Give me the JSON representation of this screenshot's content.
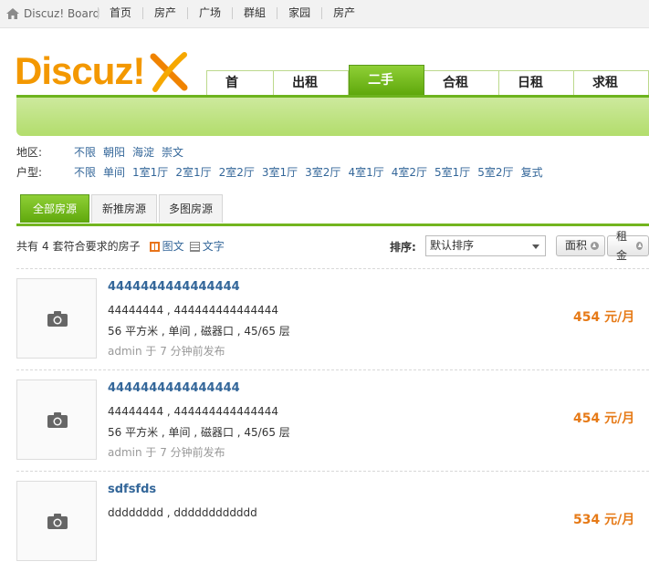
{
  "topbar": {
    "board_label": "Discuz! Board",
    "nav": [
      "首页",
      "房产",
      "广场",
      "群組",
      "家园",
      "房产"
    ]
  },
  "logo": {
    "text": "Discuz!"
  },
  "mainnav": {
    "tabs": [
      {
        "label": "首 页",
        "active": false
      },
      {
        "label": "出租房",
        "active": false
      },
      {
        "label": "二手房",
        "active": true
      },
      {
        "label": "合租房",
        "active": false
      },
      {
        "label": "日租房",
        "active": false
      },
      {
        "label": "求租房",
        "active": false
      }
    ]
  },
  "filters": {
    "area": {
      "label": "地区:",
      "options": [
        "不限",
        "朝阳",
        "海淀",
        "崇文"
      ]
    },
    "layout": {
      "label": "户型:",
      "options": [
        "不限",
        "单间",
        "1室1厅",
        "2室1厅",
        "2室2厅",
        "3室1厅",
        "3室2厅",
        "4室1厅",
        "4室2厅",
        "5室1厅",
        "5室2厅",
        "复式"
      ]
    }
  },
  "subtabs": [
    "全部房源",
    "新推房源",
    "多图房源"
  ],
  "results": {
    "prefix": "共有",
    "count": "4",
    "suffix": "套符合要求的房子",
    "view_image": "图文",
    "view_text": "文字",
    "sort_label": "排序:",
    "sort_value": "默认排序",
    "btn_area": "面积",
    "btn_rent": "租金"
  },
  "listings": [
    {
      "title": "4444444444444444",
      "line1": "44444444 , 444444444444444",
      "line2": "56 平方米 , 单间 , 磁器口 , 45/65 层",
      "line3": "admin 于 7 分钟前发布",
      "price": "454 元/月"
    },
    {
      "title": "4444444444444444",
      "line1": "44444444 , 444444444444444",
      "line2": "56 平方米 , 单间 , 磁器口 , 45/65 层",
      "line3": "admin 于 7 分钟前发布",
      "price": "454 元/月"
    },
    {
      "title": "sdfsfds",
      "line1": "dddddddd , dddddddddddd",
      "line2": "",
      "line3": "",
      "price": "534 元/月"
    }
  ],
  "colors": {
    "accent_green": "#73b51f",
    "logo_orange": "#f39800",
    "price_orange": "#e67a17",
    "link_blue": "#336699"
  }
}
